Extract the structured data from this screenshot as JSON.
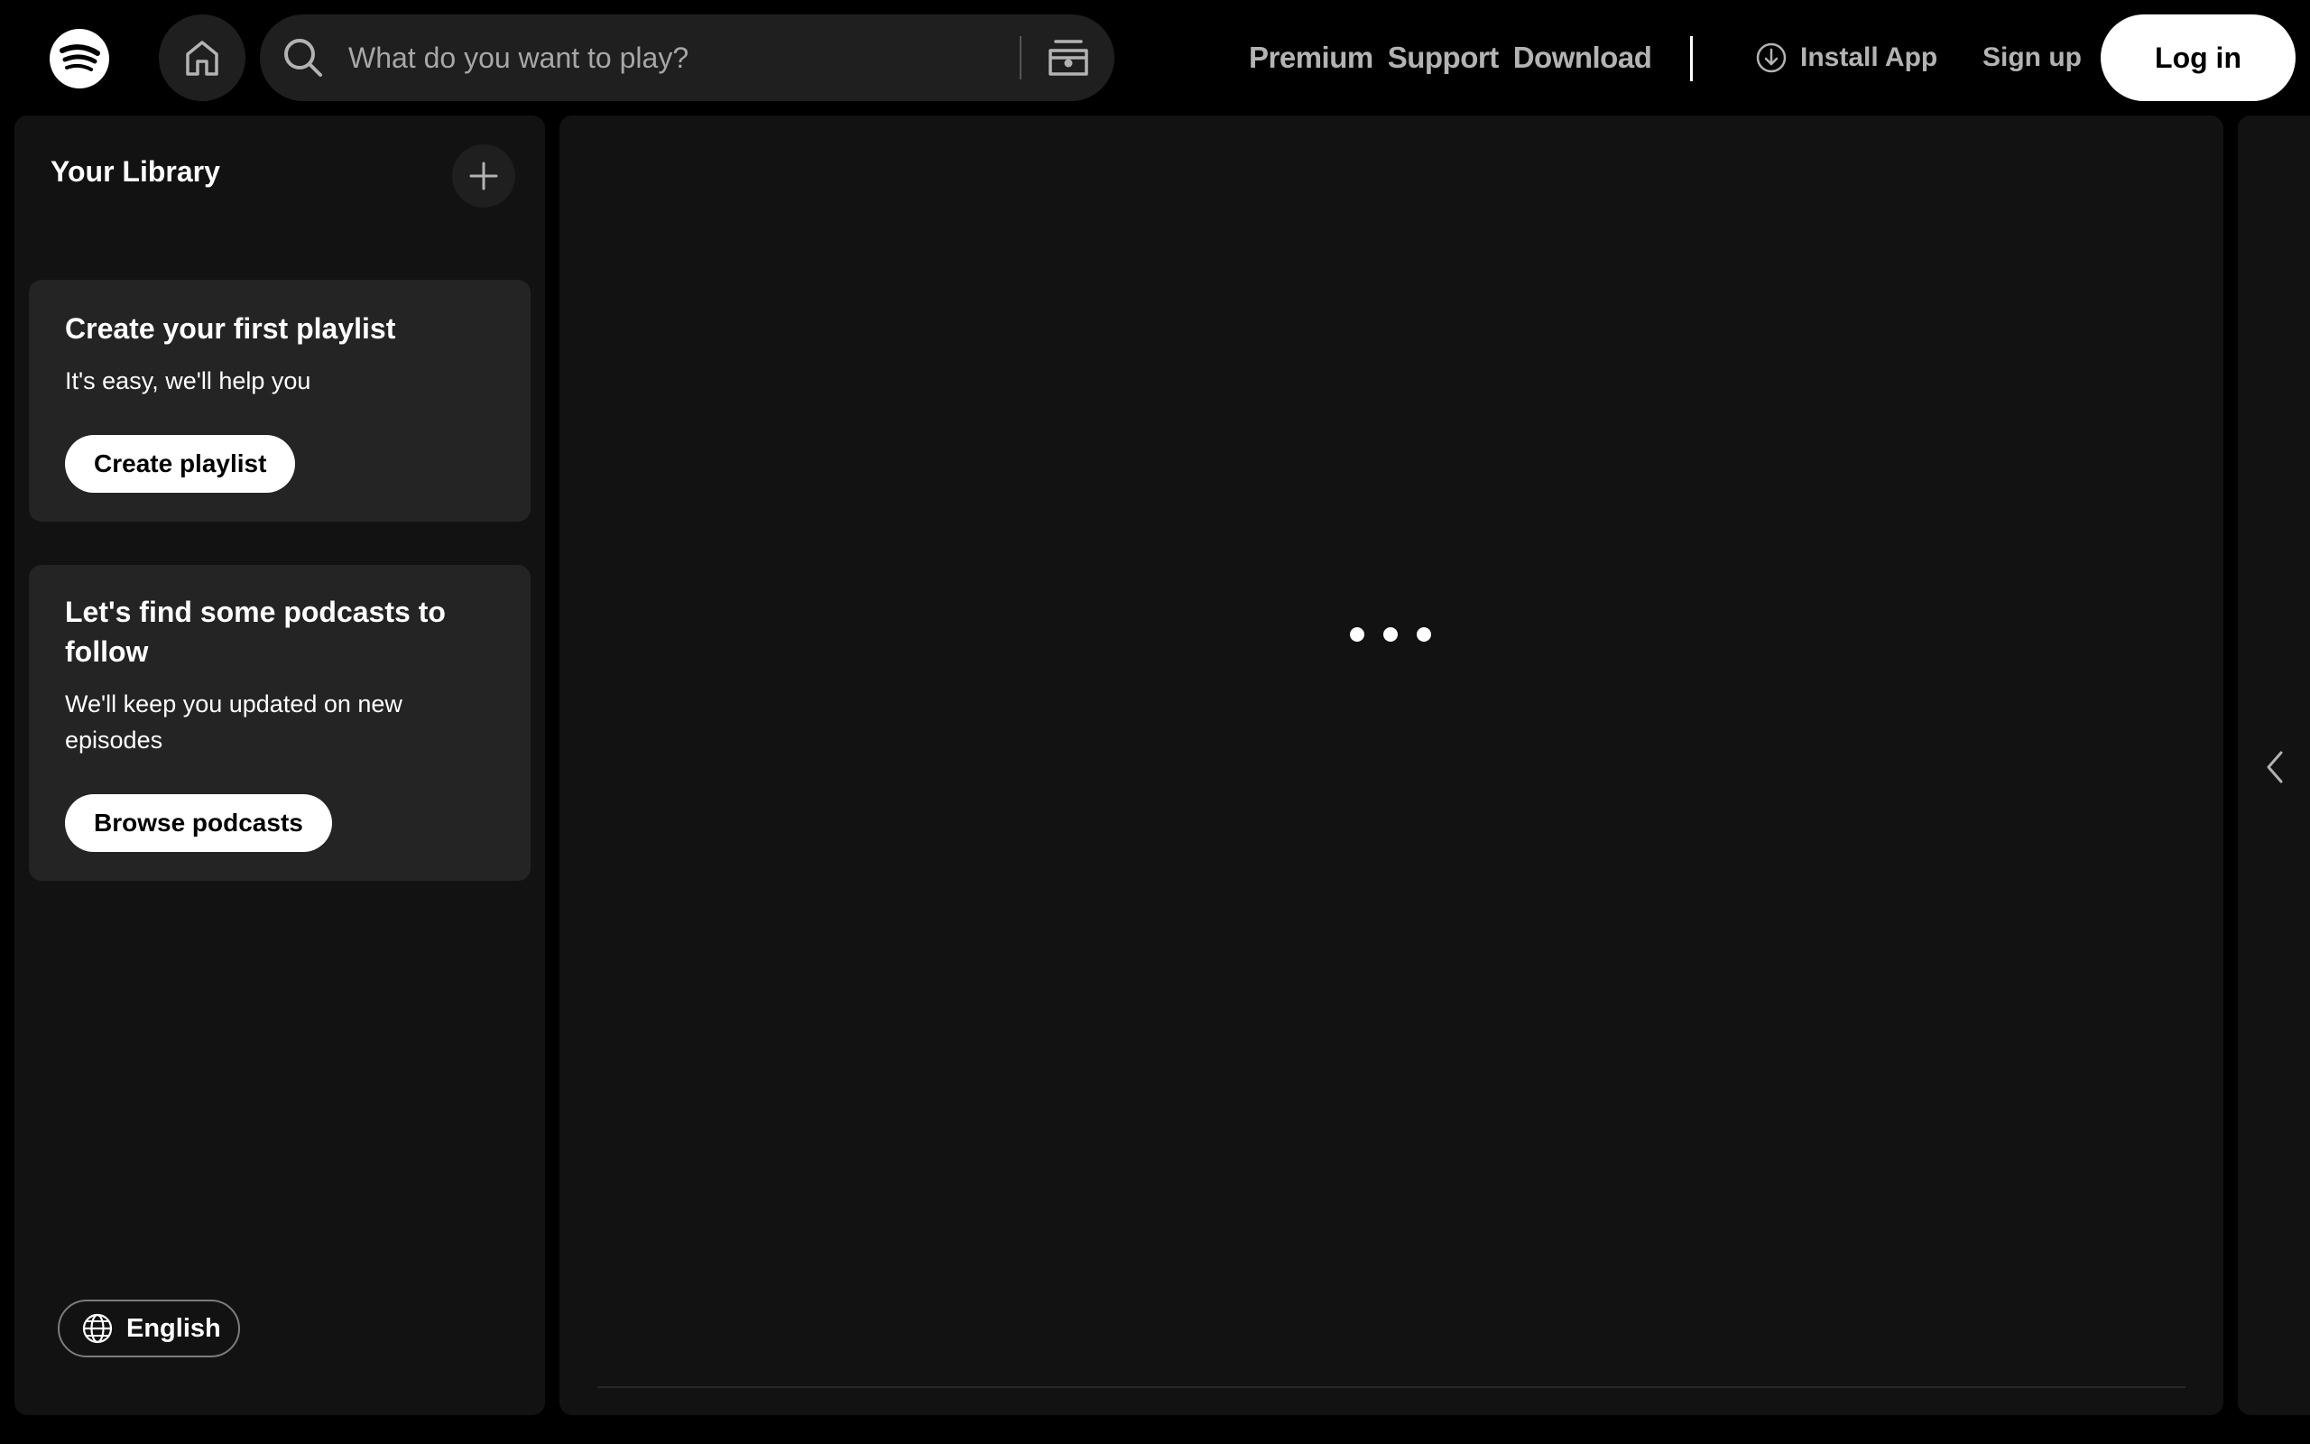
{
  "header": {
    "logo": "spotify-logo",
    "home_icon": "home-icon",
    "search": {
      "placeholder": "What do you want to play?",
      "icon": "search-icon",
      "browse_icon": "browse-icon"
    },
    "nav": {
      "premium": "Premium",
      "support": "Support",
      "download": "Download"
    },
    "install_app": "Install App",
    "signup": "Sign up",
    "login": "Log in"
  },
  "sidebar": {
    "title": "Your Library",
    "add_icon": "plus-icon",
    "cards": [
      {
        "title": "Create your first playlist",
        "text": "It's easy, we'll help you",
        "button": "Create playlist"
      },
      {
        "title": "Let's find some podcasts to follow",
        "text": "We'll keep you updated on new episodes",
        "button": "Browse podcasts"
      }
    ],
    "language": "English"
  },
  "main": {
    "loading_icon": "loading-dots-icon"
  },
  "right_panel": {
    "expand_icon": "chevron-left-icon"
  },
  "colors": {
    "background": "#000000",
    "panel": "#121212",
    "card": "#242424",
    "control": "#1f1f1f",
    "text_primary": "#ffffff",
    "text_secondary": "#b3b3b3",
    "placeholder": "#a7a7a7"
  }
}
